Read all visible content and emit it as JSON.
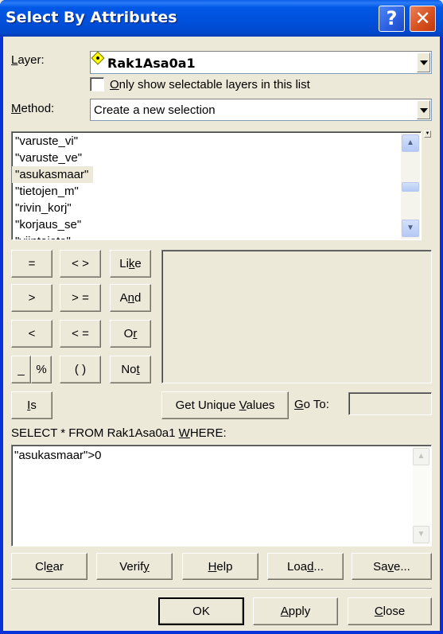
{
  "window": {
    "title": "Select By Attributes",
    "help_button": "?",
    "close_button": "✕"
  },
  "layer": {
    "label_prefix": "",
    "label_underline": "L",
    "label_rest": "ayer:",
    "value": "Rak1Asa0a1",
    "icon": "point-layer-icon"
  },
  "only_selectable": {
    "checked": false,
    "label_underline": "O",
    "label_rest": "nly show selectable layers in this list"
  },
  "method": {
    "label_underline": "M",
    "label_rest": "ethod:",
    "value": "Create a new selection"
  },
  "fields": {
    "items": [
      "\"varuste_vi\"",
      "\"varuste_ve\"",
      "\"asukasmaar\"",
      "\"tietojen_m\"",
      "\"rivin_korj\"",
      "\"korjaus_se\"",
      "\"viintojeto\""
    ],
    "selected": "\"asukasmaar\""
  },
  "operators": {
    "eq": "=",
    "ne": "< >",
    "like_a": "Li",
    "like_u": "k",
    "like_b": "e",
    "gt": ">",
    "ge": "> =",
    "and_a": "A",
    "and_u": "n",
    "and_b": "d",
    "lt": "<",
    "le": "< =",
    "or_a": "O",
    "or_u": "r",
    "underscore": "_",
    "percent": "%",
    "parens": "( )",
    "not_a": "No",
    "not_u": "t",
    "is_u": "I",
    "is_b": "s"
  },
  "unique": {
    "button_a": "Get Unique ",
    "button_u": "V",
    "button_b": "alues",
    "goto_u": "G",
    "goto_b": "o To:",
    "goto_value": ""
  },
  "query": {
    "prefix": "SELECT * FROM Rak1Asa0a1 ",
    "where_u": "W",
    "where_b": "HERE:",
    "expression": "\"asukasmaar\">0"
  },
  "actions": {
    "clear_a": "Cl",
    "clear_u": "e",
    "clear_b": "ar",
    "verify_a": "Verif",
    "verify_u": "y",
    "help_u": "H",
    "help_b": "elp",
    "load_a": "Loa",
    "load_u": "d",
    "load_b": "...",
    "save_a": "Sa",
    "save_u": "v",
    "save_b": "e..."
  },
  "footer": {
    "ok": "OK",
    "apply_u": "A",
    "apply_b": "pply",
    "close_u": "C",
    "close_b": "lose"
  }
}
